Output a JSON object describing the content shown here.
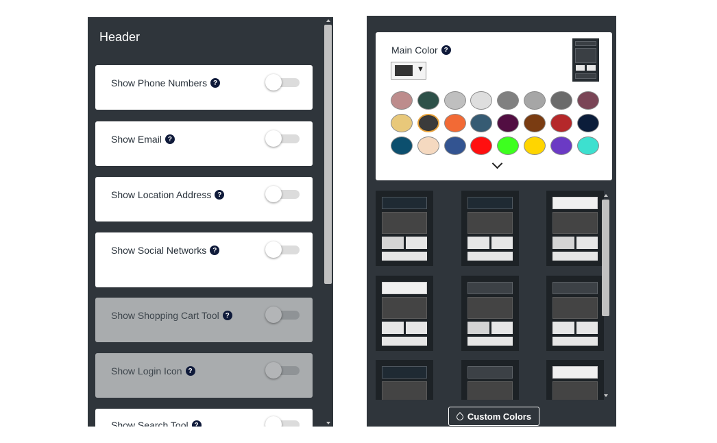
{
  "header_panel": {
    "title": "Header",
    "options": [
      {
        "label": "Show Phone Numbers",
        "enabled": false,
        "disabled": false
      },
      {
        "label": "Show Email",
        "enabled": false,
        "disabled": false
      },
      {
        "label": "Show Location Address",
        "enabled": false,
        "disabled": false
      },
      {
        "label": "Show Social Networks",
        "enabled": false,
        "disabled": false
      },
      {
        "label": "Show Shopping Cart Tool",
        "enabled": false,
        "disabled": true
      },
      {
        "label": "Show Login Icon",
        "enabled": false,
        "disabled": true
      },
      {
        "label": "Show Search Tool",
        "enabled": false,
        "disabled": false
      }
    ],
    "help_glyph": "?"
  },
  "color_panel": {
    "main_color_label": "Main Color",
    "selected_color": "#333333",
    "dropdown_arrow": "▼",
    "swatches": [
      "#bd8c8c",
      "#2e5149",
      "#bfbfbf",
      "#dedede",
      "#808080",
      "#a6a6a6",
      "#6b6b6b",
      "#7a4556",
      "#e8c87a",
      "#3b3b3b",
      "#f26a35",
      "#365b73",
      "#520e42",
      "#7a3c12",
      "#b5282a",
      "#0b1d3a",
      "#0c4f6e",
      "#f5d9c0",
      "#335491",
      "#ff0f0f",
      "#3dff1f",
      "#ffd500",
      "#6b3ac4",
      "#3de0cf"
    ],
    "selected_swatch_index": 9,
    "custom_colors_label": "Custom Colors"
  },
  "layouts": [
    {
      "top": "darkest"
    },
    {
      "top": "darkest"
    },
    {
      "top": "white"
    },
    {
      "top": "white"
    },
    {
      "top": "dark"
    },
    {
      "top": "dark"
    },
    {
      "top": "darkest"
    },
    {
      "top": "dark"
    },
    {
      "top": "white"
    }
  ]
}
